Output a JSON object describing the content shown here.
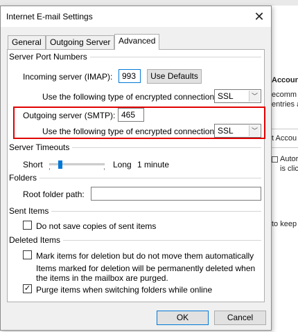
{
  "background": {
    "accounts_title": "Accoun",
    "line1": "ecomm",
    "line2": "entries a",
    "button_partial": "t Accou",
    "autosave_line1": "Autor",
    "autosave_line2": "is clic",
    "keep_partial": "to keep"
  },
  "dialog": {
    "title": "Internet E-mail Settings",
    "close_glyph": "✕",
    "tabs": [
      {
        "label": "General"
      },
      {
        "label": "Outgoing Server"
      },
      {
        "label": "Advanced"
      }
    ],
    "server_ports": {
      "group_label": "Server Port Numbers",
      "incoming_label": "Incoming server (IMAP):",
      "incoming_value": "993",
      "use_defaults_label": "Use Defaults",
      "incoming_encryption_label": "Use the following type of encrypted connection:",
      "incoming_encryption_value": "SSL",
      "outgoing_label": "Outgoing server (SMTP):",
      "outgoing_value": "465",
      "outgoing_encryption_label": "Use the following type of encrypted connection:",
      "outgoing_encryption_value": "SSL"
    },
    "timeouts": {
      "group_label": "Server Timeouts",
      "short_label": "Short",
      "long_label": "Long",
      "value_label": "1 minute",
      "slider_level": 0.18
    },
    "folders": {
      "group_label": "Folders",
      "root_label": "Root folder path:",
      "root_value": ""
    },
    "sent_items": {
      "group_label": "Sent Items",
      "no_copies_label": "Do not save copies of sent items",
      "no_copies_checked": false
    },
    "deleted_items": {
      "group_label": "Deleted Items",
      "mark_label": "Mark items for deletion but do not move them automatically",
      "mark_checked": false,
      "note_line1": "Items marked for deletion will be permanently deleted when",
      "note_line2": "the items in the mailbox are purged.",
      "purge_label": "Purge items when switching folders while online",
      "purge_checked": true
    },
    "footer": {
      "ok_label": "OK",
      "cancel_label": "Cancel"
    },
    "check_glyph": "✓",
    "dropdown_glyph": "﹀"
  },
  "colors": {
    "highlight": "#e00000",
    "accent": "#0078d7"
  }
}
